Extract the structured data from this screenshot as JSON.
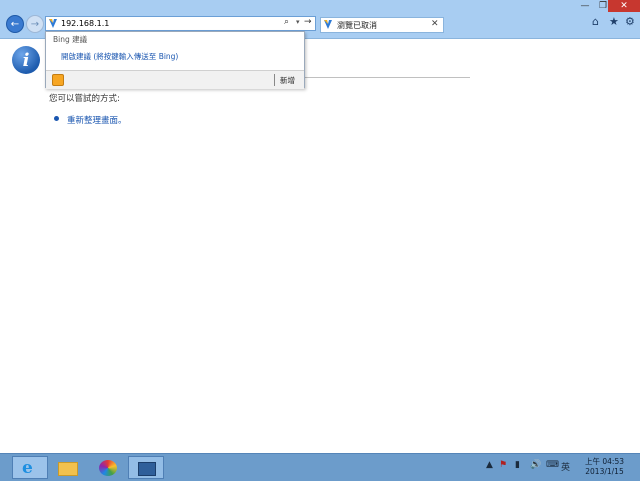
{
  "window": {
    "minimize_glyph": "—",
    "maximize_glyph": "❐",
    "close_glyph": "✕"
  },
  "nav": {
    "back_glyph": "←",
    "forward_glyph": "→"
  },
  "address_bar": {
    "value": "192.168.1.1",
    "search_glyph": "⌕",
    "dropdown_glyph": "▾",
    "go_glyph": "→"
  },
  "tab": {
    "title": "瀏覽已取消",
    "close_glyph": "✕"
  },
  "toolbar_icons": [
    "home-icon",
    "star-icon",
    "gear-icon"
  ],
  "toolbar_glyphs": {
    "home": "⌂",
    "star": "★",
    "gear": "⚙"
  },
  "suggestions": {
    "header": "Bing 建議",
    "link": "開啟建議 (將按鍵輸入傳送至 Bing)",
    "add_label": "新增"
  },
  "content": {
    "info_glyph": "i",
    "try_label": "您可以嘗試的方式:",
    "refresh_link": "重新整理畫面。"
  },
  "taskbar": {
    "apps": [
      "internet-explorer",
      "file-explorer",
      "paint",
      "network-app"
    ],
    "ie_glyph": "e",
    "tray": {
      "up_glyph": "▲",
      "flag_glyph": "⚑",
      "signal_glyph": "▮",
      "volume_glyph": "🔊",
      "keyboard_glyph": "⌨",
      "language": "英"
    },
    "clock_time": "上午 04:53",
    "clock_date": "2013/1/15"
  },
  "colors": {
    "accent": "#1a56b0",
    "titlebar": "#a8cdf2",
    "taskbar": "#6c9ccb",
    "close": "#c7372f"
  }
}
